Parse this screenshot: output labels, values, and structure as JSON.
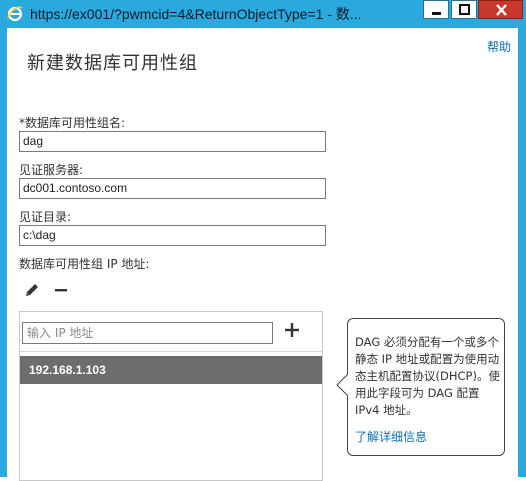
{
  "window": {
    "title": "https://ex001/?pwmcid=4&ReturnObjectType=1 - 数...",
    "accent": "#2aa9df"
  },
  "help_label": "帮助",
  "page_title": "新建数据库可用性组",
  "form": {
    "dag_name_label": "*数据库可用性组名:",
    "dag_name_value": "dag",
    "witness_server_label": "见证服务器:",
    "witness_server_value": "dc001.contoso.com",
    "witness_dir_label": "见证目录:",
    "witness_dir_value": "c:\\dag",
    "ip_label": "数据库可用性组 IP 地址:",
    "ip_placeholder": "输入 IP 地址",
    "ip_list": [
      "192.168.1.103"
    ]
  },
  "tooltip": {
    "text": "DAG 必须分配有一个或多个静态 IP 地址或配置为使用动态主机配置协议(DHCP)。使用此字段可为 DAG 配置 IPv4 地址。",
    "link": "了解详细信息"
  }
}
